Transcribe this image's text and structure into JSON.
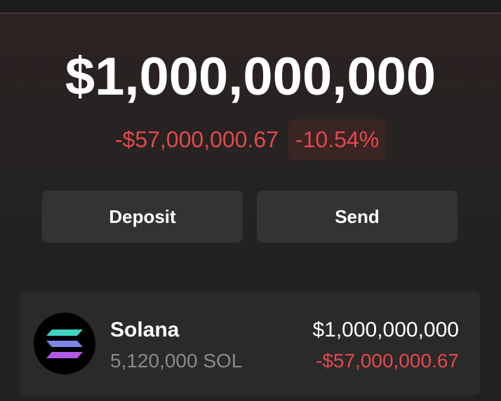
{
  "wallet": {
    "total_balance": "$1,000,000,000",
    "change_amount": "-$57,000,000.67",
    "change_percent": "-10.54%"
  },
  "actions": {
    "deposit_label": "Deposit",
    "send_label": "Send"
  },
  "tokens": [
    {
      "icon": "solana-icon",
      "name": "Solana",
      "quantity": "5,120,000 SOL",
      "value": "$1,000,000,000",
      "change": "-$57,000,000.67"
    }
  ],
  "colors": {
    "negative": "#e5484d",
    "button_bg": "#333333",
    "card_bg": "#2a2a2a",
    "text_primary": "#ffffff",
    "text_secondary": "#8a8a8a"
  }
}
